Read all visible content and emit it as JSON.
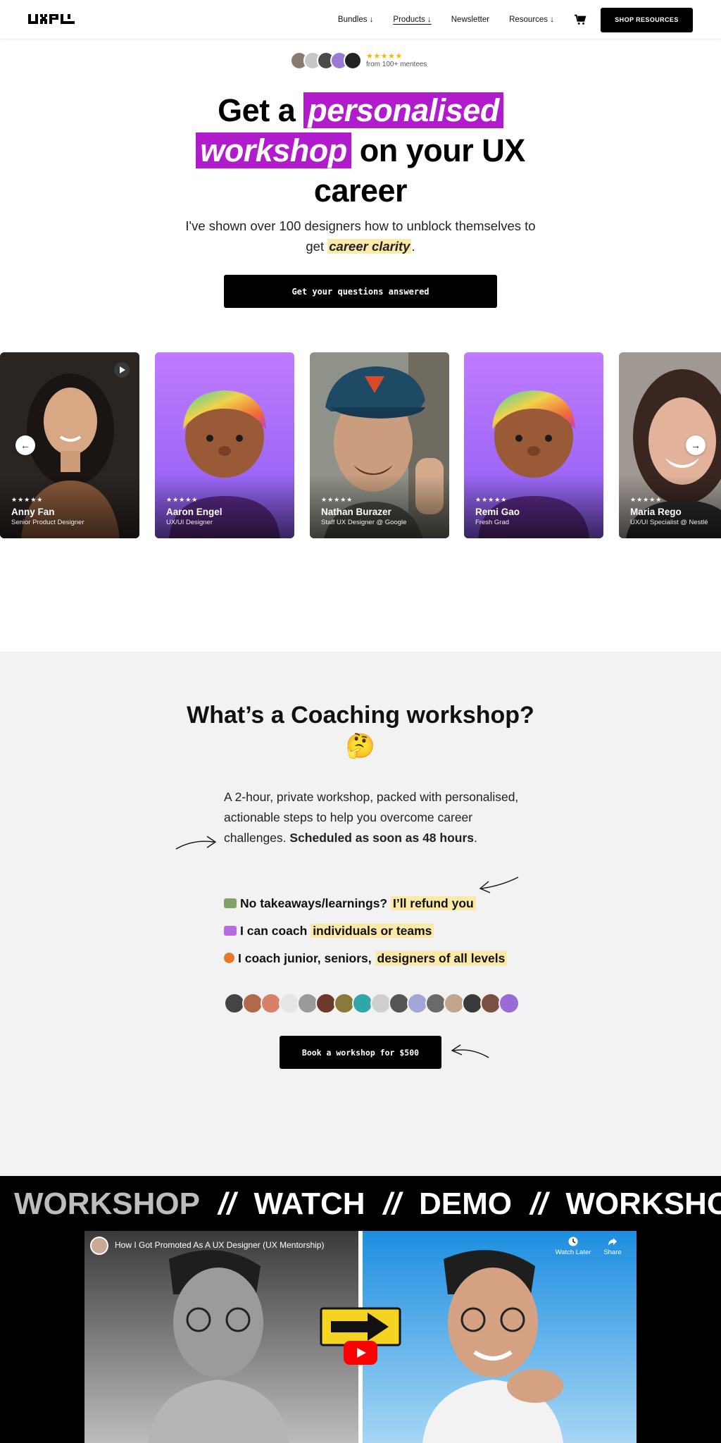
{
  "nav": {
    "logo_alt": "UXPL",
    "links": [
      {
        "label": "Bundles ↓"
      },
      {
        "label": "Products ↓"
      },
      {
        "label": "Newsletter"
      },
      {
        "label": "Resources ↓"
      }
    ],
    "cart_icon": "cart-icon",
    "shop_button": "SHOP RESOURCES"
  },
  "hero": {
    "stars": "★★★★★",
    "mentee_text": "from 100+ mentees",
    "title_1": "Get a ",
    "title_highlight_1": "personalised",
    "title_highlight_2": "workshop",
    "title_2": " on your UX career",
    "subtitle_1": "I've shown over 100 designers how to unblock themselves to get ",
    "subtitle_highlight": "career clarity",
    "subtitle_end": ".",
    "cta": "Get your questions answered"
  },
  "carousel": {
    "cards": [
      {
        "stars": "★★★★★",
        "name": "Anny Fan",
        "role": "Senior Product Designer"
      },
      {
        "stars": "★★★★★",
        "name": "Aaron Engel",
        "role": "UX/UI Designer"
      },
      {
        "stars": "★★★★★",
        "name": "Nathan Burazer",
        "role": "Staff UX Designer @ Google"
      },
      {
        "stars": "★★★★★",
        "name": "Remi Gao",
        "role": "Fresh Grad"
      },
      {
        "stars": "★★★★★",
        "name": "Maria Rego",
        "role": "UX/UI Specialist @ Nestlé"
      }
    ],
    "prev_arrow": "←",
    "next_arrow": "→"
  },
  "coaching": {
    "title": "What’s a Coaching workshop? 🤔",
    "desc_1": "A 2-hour, private workshop, packed with personalised, actionable steps to help you overcome career challenges. ",
    "desc_bold": "Scheduled as soon as 48 hours",
    "desc_end": ".",
    "bullets": [
      {
        "text": "No takeaways/learnings? ",
        "mark": "I’ll refund you",
        "color": "#7fa36b"
      },
      {
        "text": "I can coach ",
        "mark": "individuals or teams",
        "color": "#b86be0"
      },
      {
        "text": "I coach junior, seniors, ",
        "mark": "designers of all levels",
        "color": "#e8772a"
      }
    ],
    "cta": "Book a workshop for $500"
  },
  "video_section": {
    "marquee": [
      "WORKSHOP",
      "//",
      "WATCH",
      "//",
      "DEMO",
      "//",
      "WORKSHOP"
    ],
    "video_title": "How I Got Promoted As A UX Designer (UX Mentorship)",
    "watch_later": "Watch Later",
    "share": "Share"
  },
  "colors": {
    "accent_purple": "#b01ccc",
    "highlight_yellow": "#fbeaa9",
    "star_gold": "#f5b900"
  }
}
